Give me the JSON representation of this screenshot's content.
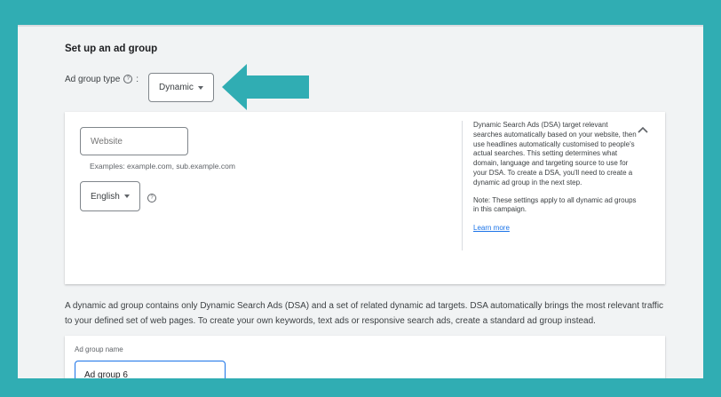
{
  "setup": {
    "title": "Set up an ad group"
  },
  "ad_group_type": {
    "label": "Ad group type",
    "colon": ":",
    "selected": "Dynamic",
    "help_icon": "help-circle-icon"
  },
  "dsa_settings": {
    "website_placeholder": "Website",
    "website_hint": "Examples: example.com, sub.example.com",
    "language_selected": "English",
    "info_paragraph_1": "Dynamic Search Ads (DSA) target relevant searches automatically based on your website, then use headlines automatically customised to people's actual searches. This setting determines what domain, language and targeting source to use for your DSA. To create a DSA, you'll need to create a dynamic ad group in the next step.",
    "info_paragraph_2": "Note: These settings apply to all dynamic ad groups in this campaign.",
    "learn_more": "Learn more",
    "collapse_icon": "chevron-up-icon"
  },
  "description": "A dynamic ad group contains only Dynamic Search Ads (DSA) and a set of related dynamic ad targets. DSA automatically brings the most relevant traffic to your defined set of web pages. To create your own keywords, text ads or responsive search ads, create a standard ad group instead.",
  "ad_group_name": {
    "label": "Ad group name",
    "value": "Ad group 6"
  },
  "colors": {
    "background": "#30adb3",
    "arrow": "#30adb3",
    "link": "#1a73e8",
    "focus_border": "#1a73e8"
  }
}
